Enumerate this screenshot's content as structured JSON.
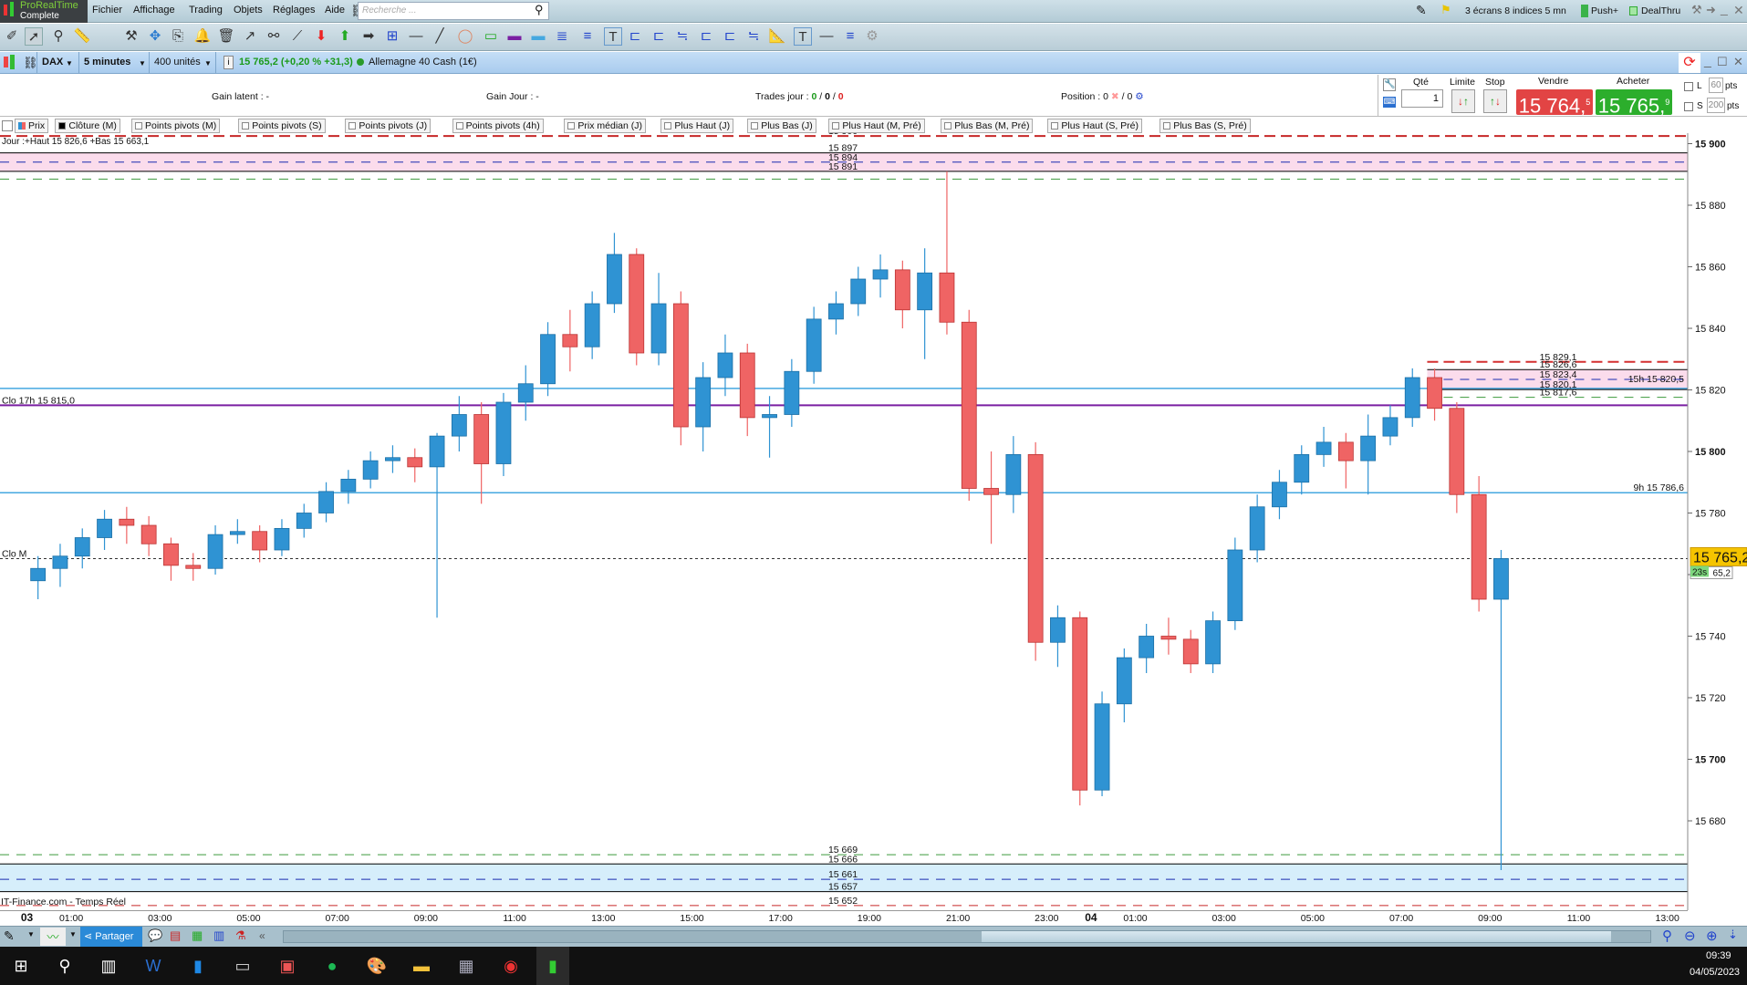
{
  "app": {
    "logo_line1": "ProRealTime",
    "logo_line2": "Complete"
  },
  "menu": [
    "Fichier",
    "Affichage",
    "Trading",
    "Objets",
    "Réglages",
    "Aide"
  ],
  "search": {
    "placeholder": "Recherche ..."
  },
  "topright": {
    "layout": "3 écrans 8 indices 5 mn",
    "push": "Push+",
    "dealthru": "DealThru"
  },
  "instrument": {
    "ticker": "DAX",
    "timeframe": "5 minutes",
    "units": "400 unités",
    "quote": "15 765,2 (+0,20 % +31,3)",
    "name": "Allemagne 40 Cash (1€)"
  },
  "orders": {
    "gain_latent": "Gain latent :  -",
    "gain_jour": "Gain Jour :  -",
    "trades_label": "Trades jour : ",
    "trades_a": "0",
    "trades_b": "0",
    "trades_c": "0",
    "position_label": "Position :  0",
    "position_b": "/ 0",
    "qty_label": "Qté",
    "qty": "1",
    "limite": "Limite",
    "stop": "Stop",
    "vendre_label": "Vendre",
    "vendre_main": "15 764,",
    "vendre_sup": "5",
    "acheter_label": "Acheter",
    "acheter_main": "15 765,",
    "acheter_sup": "9",
    "l_label": "L",
    "l_pts": "60",
    "s_label": "S",
    "s_pts": "200",
    "pts": "pts"
  },
  "legend": [
    "Prix",
    "Clôture (M)",
    "Points pivots (M)",
    "Points pivots (S)",
    "Points pivots (J)",
    "Points pivots (4h)",
    "Prix médian (J)",
    "Plus Haut (J)",
    "Plus Bas (J)",
    "Plus Haut (M, Pré)",
    "Plus Bas (M, Pré)",
    "Plus Haut (S, Pré)",
    "Plus Bas (S, Pré)"
  ],
  "chart_data": {
    "type": "candlestick",
    "colors": {
      "up": "#2f93d3",
      "down": "#ef6464"
    },
    "ylim": [
      15652,
      15903
    ],
    "y_ticks": [
      {
        "v": 15900,
        "t": "15 900",
        "bold": true
      },
      {
        "v": 15880,
        "t": "15 880"
      },
      {
        "v": 15860,
        "t": "15 860"
      },
      {
        "v": 15840,
        "t": "15 840"
      },
      {
        "v": 15820,
        "t": "15 820"
      },
      {
        "v": 15800,
        "t": "15 800",
        "bold": true
      },
      {
        "v": 15780,
        "t": "15 780"
      },
      {
        "v": 15760,
        "t": "15 760"
      },
      {
        "v": 15740,
        "t": "15 740"
      },
      {
        "v": 15720,
        "t": "15 720"
      },
      {
        "v": 15700,
        "t": "15 700",
        "bold": true
      },
      {
        "v": 15680,
        "t": "15 680"
      }
    ],
    "x_ticks": [
      {
        "at": "03/05 00:00",
        "t": "03",
        "bold": true
      },
      {
        "at": "03/05 01:00",
        "t": "01:00"
      },
      {
        "at": "03/05 03:00",
        "t": "03:00"
      },
      {
        "at": "03/05 05:00",
        "t": "05:00"
      },
      {
        "at": "03/05 07:00",
        "t": "07:00"
      },
      {
        "at": "03/05 09:00",
        "t": "09:00"
      },
      {
        "at": "03/05 11:00",
        "t": "11:00"
      },
      {
        "at": "03/05 13:00",
        "t": "13:00"
      },
      {
        "at": "03/05 15:00",
        "t": "15:00"
      },
      {
        "at": "03/05 17:00",
        "t": "17:00"
      },
      {
        "at": "03/05 19:00",
        "t": "19:00"
      },
      {
        "at": "03/05 21:00",
        "t": "21:00"
      },
      {
        "at": "03/05 23:00",
        "t": "23:00"
      },
      {
        "at": "04/05 00:00",
        "t": "04",
        "bold": true
      },
      {
        "at": "04/05 01:00",
        "t": "01:00"
      },
      {
        "at": "04/05 03:00",
        "t": "03:00"
      },
      {
        "at": "04/05 05:00",
        "t": "05:00"
      },
      {
        "at": "04/05 07:00",
        "t": "07:00"
      },
      {
        "at": "04/05 09:00",
        "t": "09:00"
      },
      {
        "at": "04/05 11:00",
        "t": "11:00"
      },
      {
        "at": "04/05 13:00",
        "t": "13:00"
      }
    ],
    "candles": [
      [
        "03/05 00:00",
        15758,
        15766,
        15752,
        15762
      ],
      [
        "03/05 00:30",
        15762,
        15770,
        15756,
        15766
      ],
      [
        "03/05 01:00",
        15766,
        15775,
        15762,
        15772
      ],
      [
        "03/05 01:30",
        15772,
        15781,
        15768,
        15778
      ],
      [
        "03/05 02:00",
        15778,
        15782,
        15770,
        15776
      ],
      [
        "03/05 02:30",
        15776,
        15779,
        15766,
        15770
      ],
      [
        "03/05 03:00",
        15770,
        15772,
        15758,
        15763
      ],
      [
        "03/05 03:30",
        15763,
        15767,
        15758,
        15762
      ],
      [
        "03/05 04:00",
        15762,
        15776,
        15760,
        15773
      ],
      [
        "03/05 04:30",
        15773,
        15778,
        15770,
        15774
      ],
      [
        "03/05 05:00",
        15774,
        15776,
        15764,
        15768
      ],
      [
        "03/05 05:30",
        15768,
        15778,
        15766,
        15775
      ],
      [
        "03/05 06:00",
        15775,
        15783,
        15772,
        15780
      ],
      [
        "03/05 06:30",
        15780,
        15790,
        15777,
        15787
      ],
      [
        "03/05 07:00",
        15787,
        15794,
        15783,
        15791
      ],
      [
        "03/05 07:30",
        15791,
        15800,
        15788,
        15797
      ],
      [
        "03/05 08:00",
        15797,
        15802,
        15793,
        15798
      ],
      [
        "03/05 08:30",
        15798,
        15801,
        15790,
        15795
      ],
      [
        "03/05 09:00",
        15795,
        15806,
        15746,
        15805
      ],
      [
        "03/05 09:30",
        15805,
        15818,
        15800,
        15812
      ],
      [
        "03/05 10:00",
        15812,
        15816,
        15783,
        15796
      ],
      [
        "03/05 10:30",
        15796,
        15819,
        15792,
        15816
      ],
      [
        "03/05 11:00",
        15816,
        15828,
        15810,
        15822
      ],
      [
        "03/05 11:30",
        15822,
        15842,
        15818,
        15838
      ],
      [
        "03/05 12:00",
        15838,
        15846,
        15826,
        15834
      ],
      [
        "03/05 12:30",
        15834,
        15852,
        15830,
        15848
      ],
      [
        "03/05 13:00",
        15848,
        15871,
        15845,
        15864
      ],
      [
        "03/05 13:30",
        15864,
        15866,
        15828,
        15832
      ],
      [
        "03/05 14:00",
        15832,
        15858,
        15828,
        15848
      ],
      [
        "03/05 14:30",
        15848,
        15852,
        15802,
        15808
      ],
      [
        "03/05 15:00",
        15808,
        15829,
        15800,
        15824
      ],
      [
        "03/05 15:30",
        15824,
        15838,
        15818,
        15832
      ],
      [
        "03/05 16:00",
        15832,
        15835,
        15805,
        15811
      ],
      [
        "03/05 16:30",
        15811,
        15818,
        15798,
        15812
      ],
      [
        "03/05 17:00",
        15812,
        15830,
        15808,
        15826
      ],
      [
        "03/05 17:30",
        15826,
        15847,
        15822,
        15843
      ],
      [
        "03/05 18:00",
        15843,
        15852,
        15838,
        15848
      ],
      [
        "03/05 18:30",
        15848,
        15860,
        15844,
        15856
      ],
      [
        "03/05 19:00",
        15856,
        15864,
        15850,
        15859
      ],
      [
        "03/05 19:30",
        15859,
        15862,
        15840,
        15846
      ],
      [
        "03/05 20:00",
        15846,
        15866,
        15830,
        15858
      ],
      [
        "03/05 20:30",
        15858,
        15891,
        15838,
        15842
      ],
      [
        "03/05 21:00",
        15842,
        15846,
        15784,
        15788
      ],
      [
        "03/05 21:30",
        15788,
        15800,
        15770,
        15786
      ],
      [
        "03/05 22:00",
        15786,
        15805,
        15780,
        15799
      ],
      [
        "03/05 22:30",
        15799,
        15803,
        15732,
        15738
      ],
      [
        "03/05 23:00",
        15738,
        15750,
        15730,
        15746
      ],
      [
        "03/05 23:30",
        15746,
        15748,
        15685,
        15690
      ],
      [
        "04/05 00:00",
        15690,
        15722,
        15688,
        15718
      ],
      [
        "04/05 00:30",
        15718,
        15736,
        15712,
        15733
      ],
      [
        "04/05 01:00",
        15733,
        15744,
        15728,
        15740
      ],
      [
        "04/05 01:30",
        15740,
        15746,
        15734,
        15739
      ],
      [
        "04/05 02:00",
        15739,
        15742,
        15728,
        15731
      ],
      [
        "04/05 02:30",
        15731,
        15748,
        15728,
        15745
      ],
      [
        "04/05 03:00",
        15745,
        15772,
        15742,
        15768
      ],
      [
        "04/05 03:30",
        15768,
        15786,
        15764,
        15782
      ],
      [
        "04/05 04:00",
        15782,
        15794,
        15778,
        15790
      ],
      [
        "04/05 04:30",
        15790,
        15802,
        15786,
        15799
      ],
      [
        "04/05 05:00",
        15799,
        15808,
        15795,
        15803
      ],
      [
        "04/05 05:30",
        15803,
        15806,
        15788,
        15797
      ],
      [
        "04/05 06:00",
        15797,
        15812,
        15786,
        15805
      ],
      [
        "04/05 06:30",
        15805,
        15815,
        15802,
        15811
      ],
      [
        "04/05 07:00",
        15811,
        15827,
        15808,
        15824
      ],
      [
        "04/05 07:30",
        15824,
        15827,
        15810,
        15814
      ],
      [
        "04/05 08:00",
        15814,
        15816,
        15780,
        15786
      ],
      [
        "04/05 08:30",
        15786,
        15792,
        15748,
        15752
      ],
      [
        "04/05 09:00",
        15752,
        15768,
        15664,
        15765.2
      ]
    ],
    "zones": [
      {
        "from": 15897,
        "to": 15891,
        "fill": "#fbdcec"
      },
      {
        "from": 15666,
        "to": 15657,
        "fill": "#d6eefb"
      },
      {
        "from": 15826.6,
        "to": 15820.1,
        "fill": "#fbdcec",
        "start": "04/05 07:35"
      }
    ],
    "levels": [
      {
        "price": 15902.5,
        "color": "#c62828",
        "dash": "12,6",
        "width": 2,
        "label": "15 900",
        "label_pos": "mid"
      },
      {
        "price": 15897,
        "color": "#000",
        "dash": "",
        "width": 1,
        "label": "15 897",
        "label_pos": "mid"
      },
      {
        "price": 15894,
        "color": "#1a2cb0",
        "dash": "10,8",
        "width": 1,
        "label": "15 894",
        "label_pos": "mid"
      },
      {
        "price": 15891,
        "color": "#000",
        "dash": "",
        "width": 1,
        "label": "15 891",
        "label_pos": "mid"
      },
      {
        "price": 15888.5,
        "color": "#3c9a3c",
        "dash": "10,8",
        "width": 1,
        "label": "",
        "label_pos": "mid"
      },
      {
        "price": 15669,
        "color": "#3c9a3c",
        "dash": "10,8",
        "width": 1,
        "label": "15 669",
        "label_pos": "mid"
      },
      {
        "price": 15666,
        "color": "#000",
        "dash": "",
        "width": 1,
        "label": "15 666",
        "label_pos": "mid"
      },
      {
        "price": 15661,
        "color": "#1a2cb0",
        "dash": "10,8",
        "width": 1,
        "label": "15 661",
        "label_pos": "mid"
      },
      {
        "price": 15657,
        "color": "#000",
        "dash": "",
        "width": 1,
        "label": "15 657",
        "label_pos": "mid"
      },
      {
        "price": 15652.5,
        "color": "#c62828",
        "dash": "10,8",
        "width": 1,
        "label": "15 652",
        "label_pos": "mid"
      },
      {
        "price": 15820.5,
        "color": "#45a8e0",
        "dash": "",
        "width": 1.5,
        "label": "",
        "label_pos": "right"
      },
      {
        "price": 15815,
        "color": "#7a1fa2",
        "dash": "",
        "width": 2,
        "label": "Clo 17h 15 815,0",
        "label_pos": "left"
      },
      {
        "price": 15786.6,
        "color": "#45a8e0",
        "dash": "",
        "width": 1.5,
        "label": "9h 15 786,6",
        "label_pos": "right"
      },
      {
        "price": 15765.2,
        "color": "#333",
        "dash": "3,3",
        "width": 1,
        "label": "Clo M",
        "label_pos": "left"
      },
      {
        "price": 15829.1,
        "color": "#d32f2f",
        "dash": "12,6",
        "width": 2,
        "label": "15 829,1",
        "label_pos": "zone",
        "start": "04/05 07:35"
      },
      {
        "price": 15826.6,
        "color": "#000",
        "dash": "",
        "width": 1,
        "label": "15 826,6",
        "label_pos": "zone",
        "start": "04/05 07:35"
      },
      {
        "price": 15823.4,
        "color": "#1a2cb0",
        "dash": "10,8",
        "width": 1,
        "label": "15 823,4",
        "label_pos": "zone",
        "start": "04/05 07:35"
      },
      {
        "price": 15820.1,
        "color": "#000",
        "dash": "",
        "width": 1,
        "label": "15 820,1",
        "label_pos": "zone",
        "start": "04/05 07:35"
      },
      {
        "price": 15817.6,
        "color": "#3c9a3c",
        "dash": "10,8",
        "width": 1,
        "label": "15 817,6",
        "label_pos": "zone",
        "start": "04/05 07:35"
      }
    ],
    "zone_note": "15h 15 820,5",
    "day_info": "Jour :+Haut 15 826,6 +Bas 15 663,1",
    "source": "IT-Finance.com - Temps Réel",
    "last_price": "15 765,2",
    "countdown": "23s",
    "last_small": "65,2"
  },
  "bottom": {
    "share": "Partager"
  },
  "clock": {
    "time": "09:39",
    "date": "04/05/2023"
  }
}
